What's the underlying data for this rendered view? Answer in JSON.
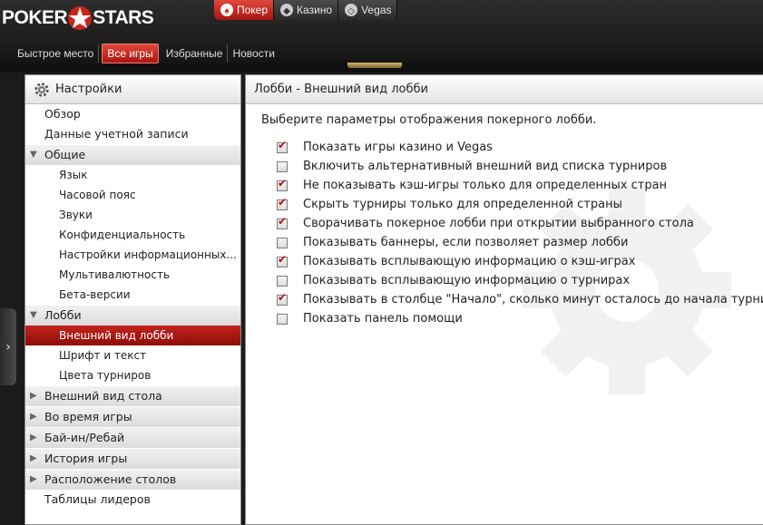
{
  "brand": {
    "left": "POKER",
    "right": "STARS"
  },
  "product_tabs": [
    {
      "label": "Покер",
      "icon": "poker-spade-icon",
      "active": true
    },
    {
      "label": "Казино",
      "icon": "dice-icon",
      "active": false
    },
    {
      "label": "Vegas",
      "icon": "vegas-icon",
      "active": false
    }
  ],
  "nav_tabs": [
    {
      "label": "Быстрое место",
      "active": false
    },
    {
      "label": "Все игры",
      "active": true
    },
    {
      "label": "Избранные",
      "active": false
    },
    {
      "label": "Новости",
      "active": false
    }
  ],
  "settings": {
    "header": "Настройки",
    "items": [
      {
        "label": "Обзор",
        "type": "top"
      },
      {
        "label": "Данные учетной записи",
        "type": "top"
      },
      {
        "label": "Общие",
        "type": "group",
        "expanded": true
      },
      {
        "label": "Язык",
        "type": "sub"
      },
      {
        "label": "Часовой пояс",
        "type": "sub"
      },
      {
        "label": "Звуки",
        "type": "sub"
      },
      {
        "label": "Конфиденциальность",
        "type": "sub"
      },
      {
        "label": "Настройки информационных...",
        "type": "sub"
      },
      {
        "label": "Мультивалютность",
        "type": "sub"
      },
      {
        "label": "Бета-версии",
        "type": "sub"
      },
      {
        "label": "Лобби",
        "type": "group",
        "expanded": true
      },
      {
        "label": "Внешний вид лобби",
        "type": "sub",
        "selected": true
      },
      {
        "label": "Шрифт и текст",
        "type": "sub"
      },
      {
        "label": "Цвета турниров",
        "type": "sub"
      },
      {
        "label": "Внешний вид стола",
        "type": "group",
        "expanded": false
      },
      {
        "label": "Во время игры",
        "type": "group",
        "expanded": false
      },
      {
        "label": "Бай-ин/Ребай",
        "type": "group",
        "expanded": false
      },
      {
        "label": "История игры",
        "type": "group",
        "expanded": false
      },
      {
        "label": "Расположение столов",
        "type": "group",
        "expanded": false
      },
      {
        "label": "Таблицы лидеров",
        "type": "top"
      }
    ]
  },
  "content": {
    "title": "Лобби - Внешний вид лобби",
    "description": "Выберите параметры отображения покерного лобби.",
    "options": [
      {
        "label": "Показать игры казино и Vegas",
        "checked": true
      },
      {
        "label": "Включить альтернативный внешний вид списка турниров",
        "checked": false
      },
      {
        "label": "Не показывать кэш-игры только для определенных стран",
        "checked": true
      },
      {
        "label": "Скрыть турниры только для определенной страны",
        "checked": true
      },
      {
        "label": "Сворачивать покерное лобби при открытии выбранного стола",
        "checked": true
      },
      {
        "label": "Показывать баннеры, если позволяет размер лобби",
        "checked": false
      },
      {
        "label": "Показывать всплывающую информацию о кэш-играх",
        "checked": true
      },
      {
        "label": "Показывать всплывающую информацию о турнирах",
        "checked": false
      },
      {
        "label": "Показывать в столбце \"Начало\", сколько минут осталось до начала турнира",
        "checked": true
      },
      {
        "label": "Показать панель помощи",
        "checked": false
      }
    ]
  },
  "colors": {
    "accent": "#b81a14",
    "check": "#b01010"
  }
}
